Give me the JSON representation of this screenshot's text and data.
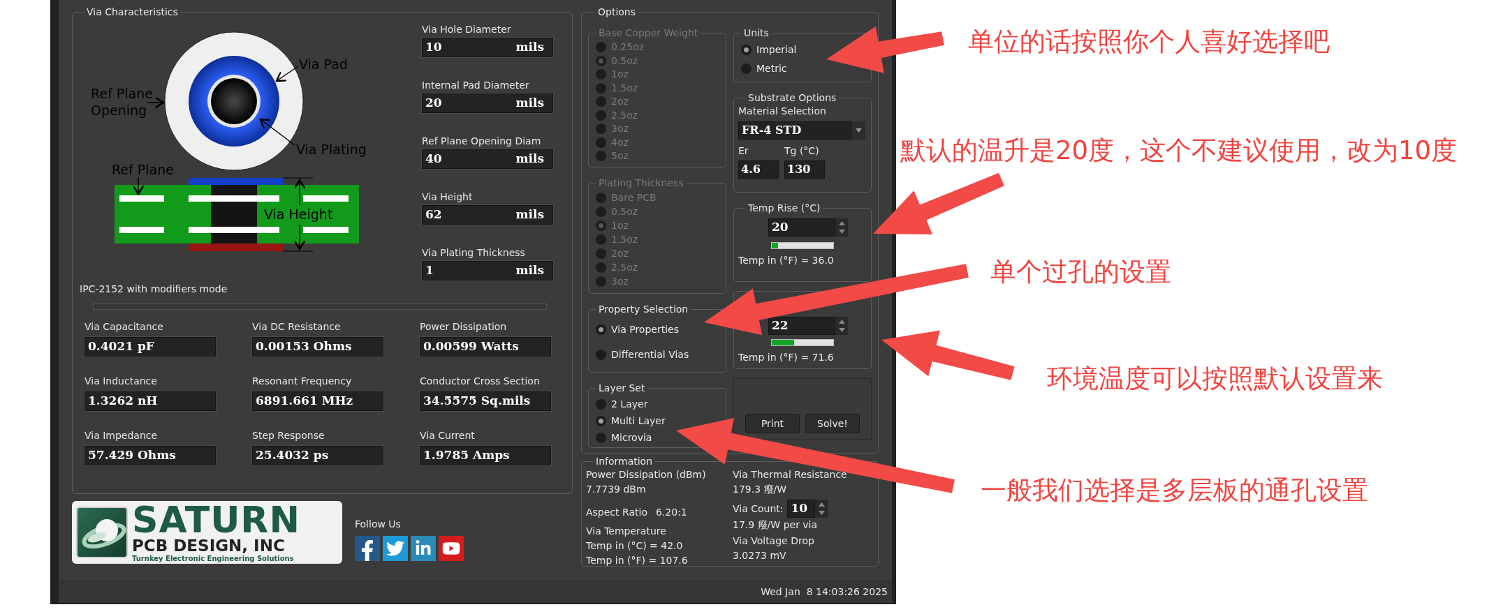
{
  "via_characteristics": {
    "title": "Via Characteristics",
    "diagram_labels": [
      {
        "kind": "via_pad",
        "text": "Via Pad"
      },
      {
        "kind": "ref_plane_opening",
        "text": "Ref Plane Opening"
      },
      {
        "kind": "via_plating",
        "text": "Via Plating"
      },
      {
        "kind": "ref_plane",
        "text": "Ref Plane"
      },
      {
        "kind": "via_height",
        "text": "Via Height"
      }
    ],
    "inputs": [
      {
        "label": "Via Hole Diameter",
        "value": "10",
        "unit": "mils"
      },
      {
        "label": "Internal Pad Diameter",
        "value": "20",
        "unit": "mils"
      },
      {
        "label": "Ref Plane Opening Diam",
        "value": "40",
        "unit": "mils"
      },
      {
        "label": "Via Height",
        "value": "62",
        "unit": "mils"
      },
      {
        "label": "Via Plating Thickness",
        "value": "1",
        "unit": "mils"
      }
    ],
    "mode_text": "IPC-2152 with modifiers mode",
    "results": [
      {
        "label": "Via Capacitance",
        "value": "0.4021 pF"
      },
      {
        "label": "Via DC Resistance",
        "value": "0.00153 Ohms"
      },
      {
        "label": "Power Dissipation",
        "value": "0.00599 Watts"
      },
      {
        "label": "Via Inductance",
        "value": "1.3262 nH"
      },
      {
        "label": "Resonant Frequency",
        "value": "6891.661 MHz"
      },
      {
        "label": "Conductor Cross Section",
        "value": "34.5575 Sq.mils"
      },
      {
        "label": "Via Impedance",
        "value": "57.429 Ohms"
      },
      {
        "label": "Step Response",
        "value": "25.4032 ps"
      },
      {
        "label": "Via Current",
        "value": "1.9785 Amps"
      }
    ]
  },
  "logo": {
    "name": "SATURN",
    "line2": "PCB DESIGN, INC",
    "tagline": "Turnkey Electronic Engineering Solutions"
  },
  "follow_label": "Follow Us",
  "options": {
    "title": "Options",
    "base_copper_weight": {
      "title": "Base Copper Weight",
      "disabled": true,
      "options": [
        {
          "label": "0.25oz",
          "selected": false
        },
        {
          "label": "0.5oz",
          "selected": true
        },
        {
          "label": "1oz",
          "selected": false
        },
        {
          "label": "1.5oz",
          "selected": false
        },
        {
          "label": "2oz",
          "selected": false
        },
        {
          "label": "2.5oz",
          "selected": false
        },
        {
          "label": "3oz",
          "selected": false
        },
        {
          "label": "4oz",
          "selected": false
        },
        {
          "label": "5oz",
          "selected": false
        }
      ]
    },
    "plating_thickness": {
      "title": "Plating Thickness",
      "disabled": true,
      "options": [
        {
          "label": "Bare PCB",
          "selected": false
        },
        {
          "label": "0.5oz",
          "selected": false
        },
        {
          "label": "1oz",
          "selected": true
        },
        {
          "label": "1.5oz",
          "selected": false
        },
        {
          "label": "2oz",
          "selected": false
        },
        {
          "label": "2.5oz",
          "selected": false
        },
        {
          "label": "3oz",
          "selected": false
        }
      ]
    },
    "property_selection": {
      "title": "Property Selection",
      "disabled": false,
      "options": [
        {
          "label": "Via Properties",
          "selected": true
        },
        {
          "label": "Differential Vias",
          "selected": false
        }
      ]
    },
    "layer_set": {
      "title": "Layer Set",
      "disabled": false,
      "options": [
        {
          "label": "2 Layer",
          "selected": false
        },
        {
          "label": "Multi Layer",
          "selected": true
        },
        {
          "label": "Microvia",
          "selected": false
        }
      ]
    },
    "units": {
      "title": "Units",
      "disabled": false,
      "options": [
        {
          "label": "Imperial",
          "selected": true
        },
        {
          "label": "Metric",
          "selected": false
        }
      ]
    },
    "substrate": {
      "title": "Substrate Options",
      "material_label": "Material Selection",
      "material": "FR-4 STD",
      "er_label": "Er",
      "er": "4.6",
      "tg_label": "Tg (°C)",
      "tg": "130"
    },
    "temp_rise": {
      "title": "Temp Rise (°C)",
      "value": "20",
      "level": 0.1,
      "reading": "Temp in (°F) = 36.0"
    },
    "ambient": {
      "value": "22",
      "level": 0.36,
      "reading": "Temp in (°F) = 71.6"
    },
    "buttons": [
      "Print",
      "Solve!"
    ]
  },
  "information": {
    "title": "Information",
    "power_label": "Power Dissipation (dBm)",
    "power_value": "7.7739 dBm",
    "aspect_label": "Aspect Ratio",
    "aspect_value": "6.20:1",
    "temp_label": "Via Temperature",
    "temp_c": "Temp in (°C) = 42.0",
    "temp_f": "Temp in (°F) = 107.6",
    "thermal_label": "Via Thermal Resistance",
    "thermal_value": "179.3 癈/W",
    "count_label": "Via Count:",
    "count_value": "10",
    "per_via": "17.9 癈/W per via",
    "drop_label": "Via Voltage Drop",
    "drop_value": "3.0273 mV"
  },
  "status_bar": {
    "datetime": "Wed Jan  8 14:03:26 2025"
  },
  "annotations": [
    "单位的话按照你个人喜好选择吧",
    "默认的温升是20度，这个不建议使用，改为10度",
    "单个过孔的设置",
    "环境温度可以按照默认设置来",
    "一般我们选择是多层板的通孔设置"
  ]
}
